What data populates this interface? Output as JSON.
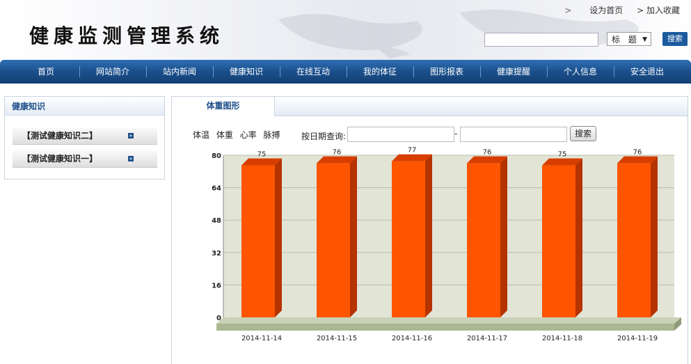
{
  "header": {
    "logo": "健康监测管理系统",
    "links": [
      ">",
      "设为首页",
      "> 加入收藏"
    ],
    "search": {
      "placeholder": "",
      "select_value": "标  题",
      "button": "搜索"
    }
  },
  "nav": [
    "首页",
    "网站简介",
    "站内新闻",
    "健康知识",
    "在线互动",
    "我的体征",
    "图形报表",
    "健康提醒",
    "个人信息",
    "安全退出"
  ],
  "sidebar": {
    "title": "健康知识",
    "items": [
      "【测试健康知识二】",
      "【测试健康知识一】"
    ]
  },
  "main": {
    "tab": "体重图形",
    "filters": [
      "体温",
      "体重",
      "心率",
      "脉搏"
    ],
    "date_label": "按日期查询:",
    "dash": "-",
    "query_button": "搜索"
  },
  "chart_data": {
    "type": "bar",
    "categories": [
      "2014-11-14",
      "2014-11-15",
      "2014-11-16",
      "2014-11-17",
      "2014-11-18",
      "2014-11-19"
    ],
    "values": [
      75,
      76,
      77,
      76,
      75,
      76
    ],
    "ylim": [
      0,
      80
    ],
    "yticks": [
      0,
      16,
      32,
      48,
      64,
      80
    ],
    "bar_color": "#ff5500",
    "plot_bg": "#e2e4d6",
    "floor_color": "#aab791"
  },
  "colors": {
    "nav": "#1b4f8c",
    "accent": "#1d4f8a"
  }
}
